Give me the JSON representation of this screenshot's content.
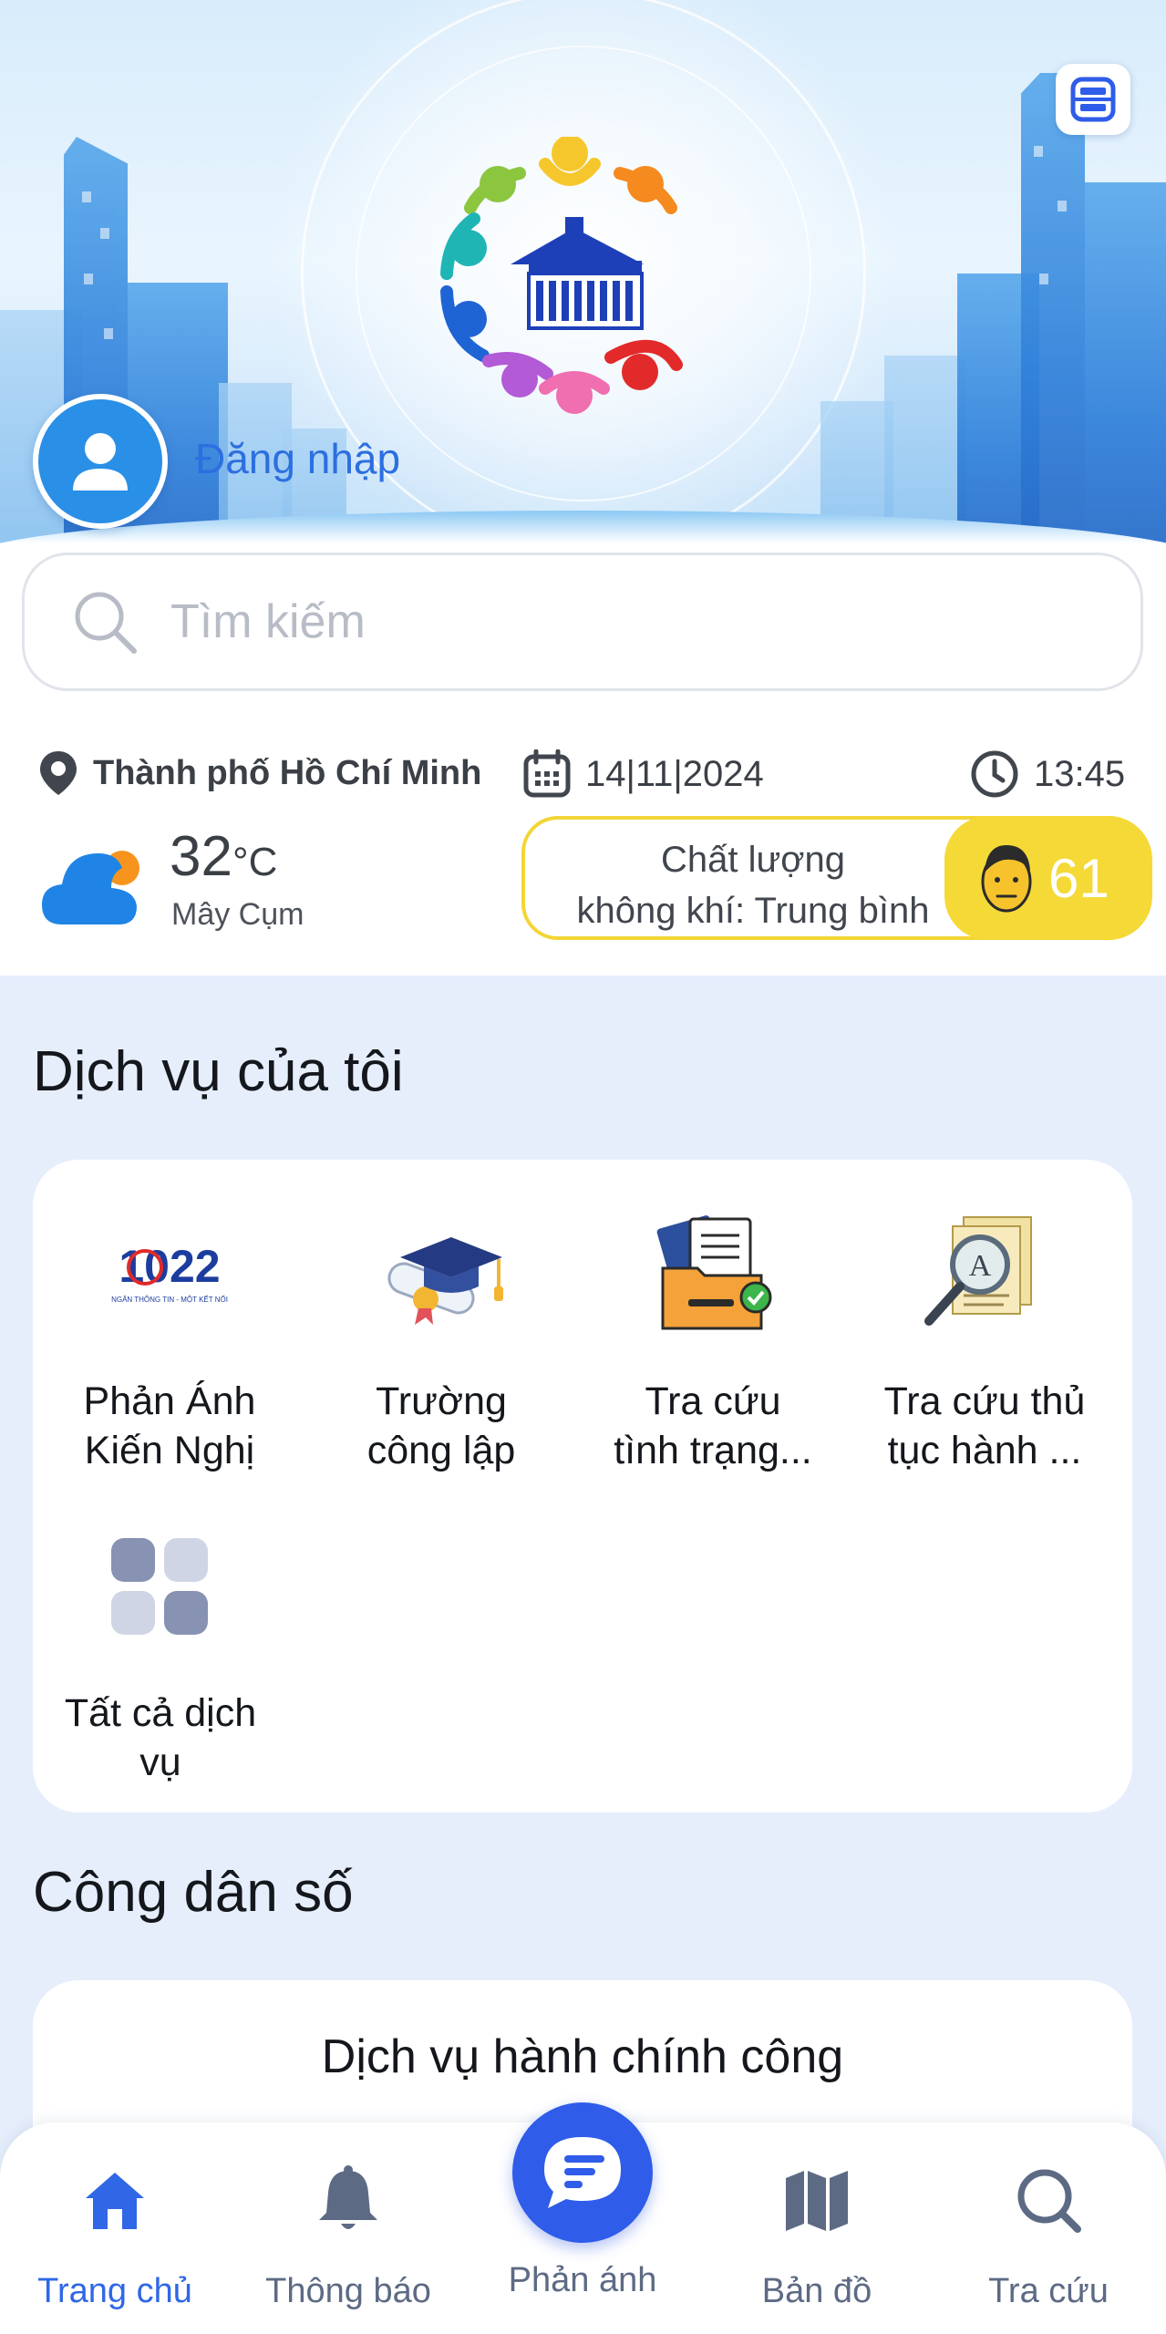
{
  "header": {
    "login_label": "Đăng nhập",
    "qr_icon": "scan-icon",
    "logo_icon": "city-logo"
  },
  "search": {
    "placeholder": "Tìm kiếm"
  },
  "info": {
    "location": "Thành phố Hồ Chí Minh",
    "date": "14|11|2024",
    "time": "13:45",
    "temperature": "32",
    "temperature_unit": "°C",
    "condition": "Mây Cụm",
    "air_quality_line1": "Chất lượng",
    "air_quality_line2": "không khí: Trung bình",
    "aqi_value": "61",
    "aqi_color": "#f5d937"
  },
  "my_services": {
    "title": "Dịch vụ của tôi",
    "items": [
      {
        "label_line1": "Phản Ánh",
        "label_line2": "Kiến Nghị",
        "icon": "hotline-1022-icon"
      },
      {
        "label_line1": "Trường",
        "label_line2": "công lập",
        "icon": "graduation-cap-icon"
      },
      {
        "label_line1": "Tra cứu",
        "label_line2": "tình trạng...",
        "icon": "folder-documents-icon"
      },
      {
        "label_line1": "Tra cứu thủ",
        "label_line2": "tục hành ...",
        "icon": "magnifier-document-icon"
      },
      {
        "label_line1": "Tất cả dịch",
        "label_line2": "vụ",
        "icon": "grid-apps-icon"
      }
    ],
    "hotline_logo_text": "1022",
    "hotline_logo_subtext": "NGÂN THÔNG TIN - MỘT KẾT NỐI"
  },
  "digital_citizen": {
    "title": "Công dân số",
    "card_title": "Dịch vụ hành chính công"
  },
  "bottom_nav": {
    "items": [
      {
        "label": "Trang chủ",
        "icon": "home-icon",
        "active": true
      },
      {
        "label": "Thông báo",
        "icon": "bell-icon",
        "active": false
      },
      {
        "label": "Phản ánh",
        "icon": "chat-icon",
        "active": false
      },
      {
        "label": "Bản đồ",
        "icon": "map-icon",
        "active": false
      },
      {
        "label": "Tra cứu",
        "icon": "search-icon",
        "active": false
      }
    ]
  },
  "colors": {
    "primary": "#2f67e6",
    "accent_yellow": "#f5d937",
    "nav_inactive": "#5d6a84"
  }
}
